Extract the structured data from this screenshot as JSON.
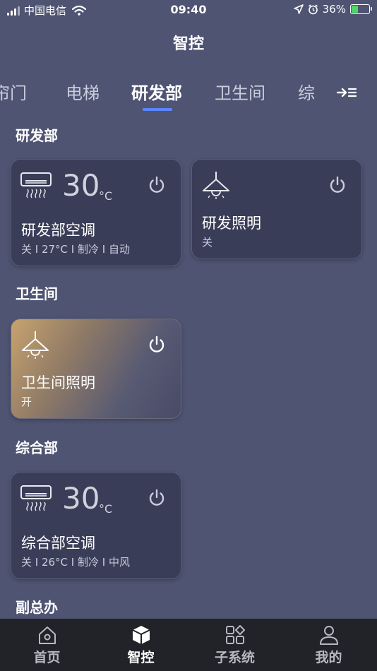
{
  "status_bar": {
    "carrier": "中国电信",
    "time": "09:40",
    "battery": "36%"
  },
  "page": {
    "title": "智控"
  },
  "tabs": [
    {
      "label": "帘门"
    },
    {
      "label": "电梯"
    },
    {
      "label": "研发部"
    },
    {
      "label": "卫生间"
    },
    {
      "label": "综"
    }
  ],
  "sections": [
    {
      "title": "研发部"
    },
    {
      "title": "卫生间"
    },
    {
      "title": "综合部"
    },
    {
      "title": "副总办"
    }
  ],
  "devices": {
    "rd_ac": {
      "temp": "30",
      "unit": "°C",
      "name": "研发部空调",
      "status": "关 I 27°C I 制冷 I 自动"
    },
    "rd_light": {
      "name": "研发照明",
      "status": "关"
    },
    "wc_light": {
      "name": "卫生间照明",
      "status": "开"
    },
    "zh_ac": {
      "temp": "30",
      "unit": "°C",
      "name": "综合部空调",
      "status": "关 I 26°C I 制冷 I 中风"
    }
  },
  "bottom_nav": [
    {
      "label": "首页"
    },
    {
      "label": "智控"
    },
    {
      "label": "子系统"
    },
    {
      "label": "我的"
    }
  ],
  "colors": {
    "background": "#4f5472",
    "card": "#3a3d57",
    "accent": "#5b86ff",
    "nav_bg": "#222329"
  }
}
